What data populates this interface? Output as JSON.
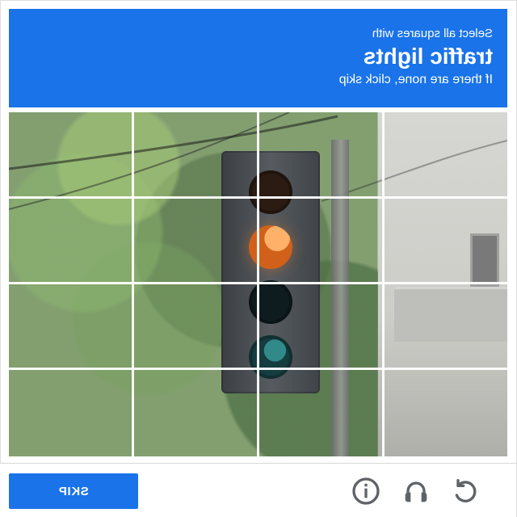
{
  "header": {
    "line1": "Select all squares with",
    "line2": "traffic lights",
    "line3": "If there are none, click skip"
  },
  "grid": {
    "rows": 4,
    "cols": 4
  },
  "footer": {
    "skip_label": "SKIP",
    "icons": [
      "info-icon",
      "headphones-icon",
      "refresh-icon"
    ]
  },
  "colors": {
    "accent": "#1a73e8"
  }
}
